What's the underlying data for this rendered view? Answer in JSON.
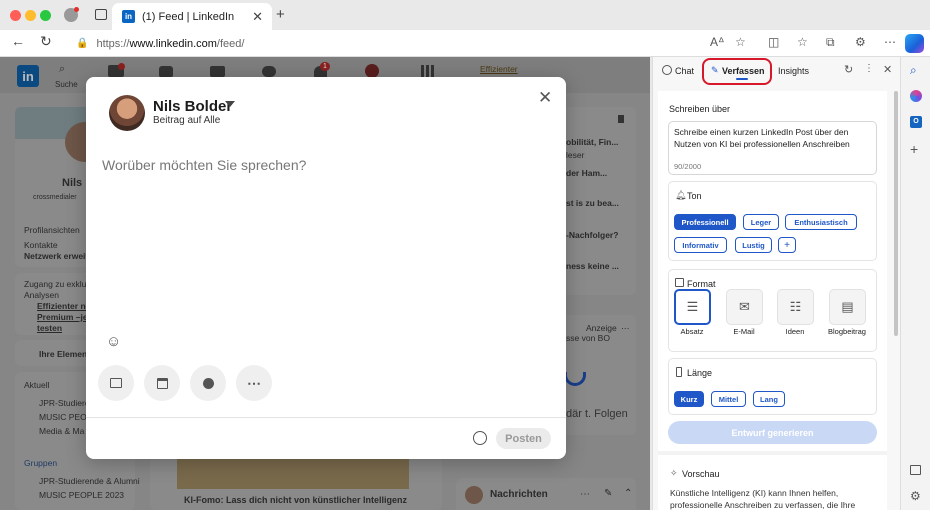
{
  "browser": {
    "tab_title": "(1) Feed | LinkedIn",
    "tab_favicon_text": "in",
    "url_scheme": "https://",
    "url_host": "www.linkedin.com",
    "url_path": "/feed/",
    "icons": [
      "back-icon",
      "reload-icon",
      "tracking-icon",
      "read-aloud-icon",
      "favorite-icon",
      "split-screen-icon",
      "favorites-icon",
      "collections-icon",
      "extensions-icon",
      "more-icon",
      "copilot-icon"
    ]
  },
  "linkedin": {
    "logo": "in",
    "nav": {
      "search_label": "Suche",
      "home_badge": "",
      "notif_badge": "1",
      "premium_link": "Effizienter"
    },
    "profile": {
      "name_fragment": "Nils B",
      "subtitle": "crossmedialer",
      "stats": [
        {
          "label": "Profilansichten"
        },
        {
          "label": "Kontakte"
        },
        {
          "label": "Netzwerk erweit"
        }
      ]
    },
    "premium": {
      "line1": "Zugang zu exklu",
      "line2": "Analysen",
      "link1": "Effizienter ne",
      "link2": "Premium –jet",
      "link3": "testen"
    },
    "my_items": "Ihre Elemente",
    "recent": {
      "header": "Aktuell",
      "items": [
        "JPR-Studierende",
        "MUSIC PEOPLE",
        "Media & Ma"
      ]
    },
    "groups": {
      "header": "Gruppen",
      "items": [
        "JPR-Studierende & Alumni",
        "MUSIC PEOPLE 2023"
      ]
    },
    "news": {
      "items": [
        "obilität, Fin...",
        "leser",
        "der Ham...",
        "st is zu bea...",
        "-Nachfolger?",
        "ness keine ..."
      ]
    },
    "ad": {
      "label": "Anzeige",
      "sub": "sse von BO",
      "follow": "där t. Folgen"
    },
    "feed_post_title": "KI-Fomo: Lass dich nicht von künstlicher Intelligenz",
    "messages_label": "Nachrichten"
  },
  "modal": {
    "author_name": "Nils Bolder",
    "visibility": "Beitrag auf Alle",
    "placeholder": "Worüber möchten Sie sprechen?",
    "post_button": "Posten",
    "icons": [
      "emoji-icon",
      "image-icon",
      "calendar-icon",
      "celebrate-icon",
      "more-icon",
      "clock-icon",
      "close-icon"
    ]
  },
  "sidebar": {
    "tabs": [
      {
        "label": "Chat"
      },
      {
        "label": "Verfassen",
        "active": true
      },
      {
        "label": "Insights"
      }
    ],
    "write_about_label": "Schreiben über",
    "prompt_text": "Schreibe einen kurzen LinkedIn Post über den Nutzen von KI bei professionellen Anschreiben",
    "char_count": "90/2000",
    "tone": {
      "label": "Ton",
      "options": [
        {
          "label": "Professionell",
          "selected": true
        },
        {
          "label": "Leger"
        },
        {
          "label": "Enthusiastisch"
        },
        {
          "label": "Informativ"
        },
        {
          "label": "Lustig"
        },
        {
          "label": "+"
        }
      ]
    },
    "format": {
      "label": "Format",
      "options": [
        {
          "label": "Absatz",
          "selected": true
        },
        {
          "label": "E-Mail"
        },
        {
          "label": "Ideen"
        },
        {
          "label": "Blogbeitrag"
        }
      ]
    },
    "length": {
      "label": "Länge",
      "options": [
        {
          "label": "Kurz",
          "selected": true
        },
        {
          "label": "Mittel"
        },
        {
          "label": "Lang"
        }
      ]
    },
    "generate_button": "Entwurf generieren",
    "preview": {
      "label": "Vorschau",
      "text": "Künstliche Intelligenz (KI) kann Ihnen helfen, professionelle Anschreiben zu verfassen, die Ihre"
    }
  },
  "colors": {
    "accent": "#1f57c8",
    "linkedin_blue": "#0a66c2",
    "highlight": "#d6182a",
    "generate_disabled": "#c9d8f5"
  }
}
